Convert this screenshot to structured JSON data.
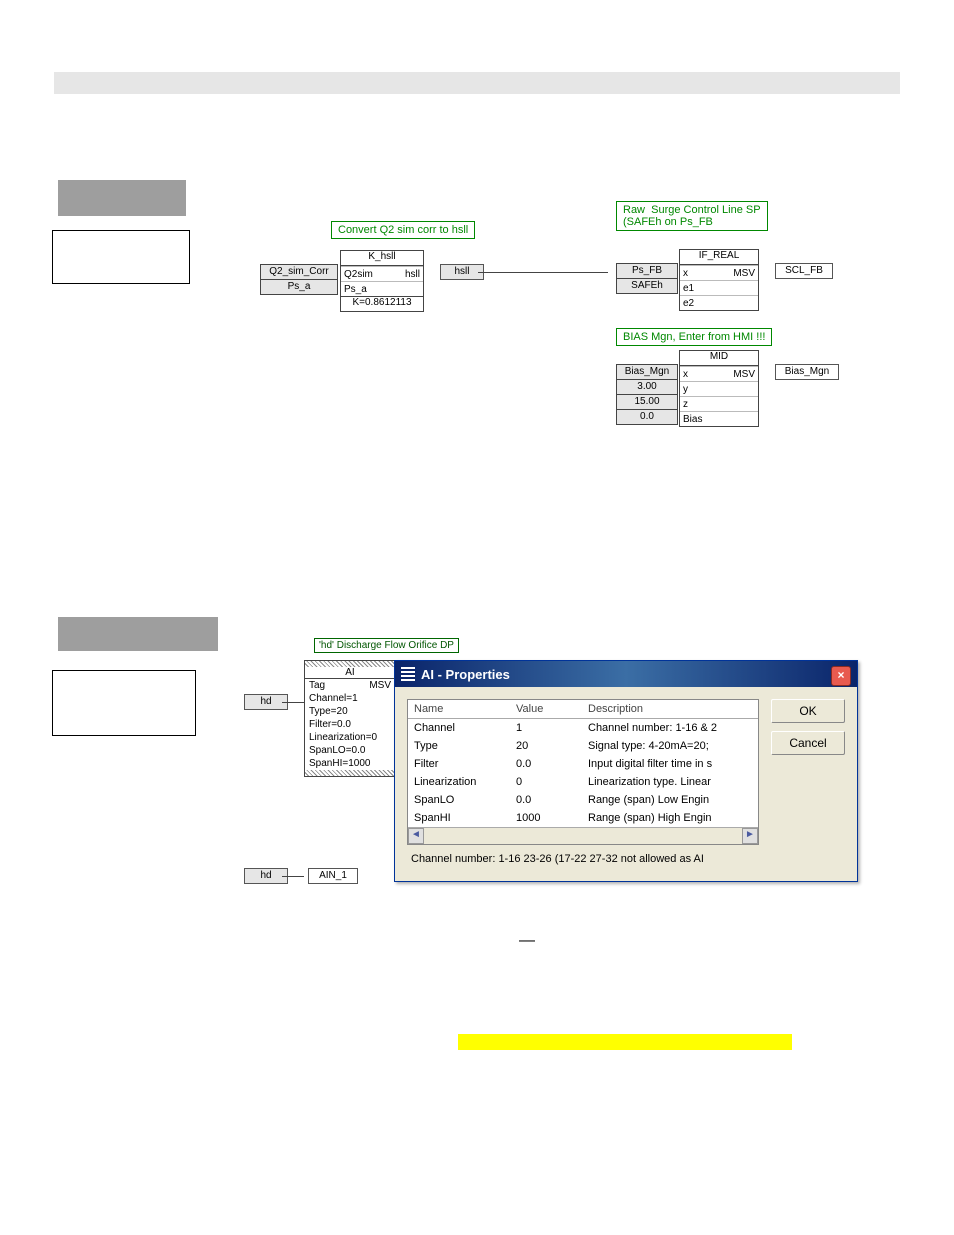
{
  "diagram_top": {
    "label_convert": "Convert Q2 sim corr to hsll",
    "kblock": {
      "title": "K_hsll",
      "in1": "Q2sim",
      "out": "hsll",
      "in2": "Ps_a",
      "k": "K=0.8612113"
    },
    "in_q2": "Q2_sim_Corr",
    "in_psa": "Ps_a",
    "var_hsll": "hsll",
    "label_raw": "Raw  Surge Control Line SP\n(SAFEh on Ps_FB",
    "if_real": {
      "title": "IF_REAL",
      "x": "x",
      "msv": "MSV",
      "e1": "e1",
      "e2": "e2",
      "in_ps": "Ps_FB",
      "in_safe": "SAFEh",
      "out": "SCL_FB"
    },
    "label_bias": "BIAS Mgn, Enter from HMI !!!",
    "mid": {
      "title": "MID",
      "x": "x",
      "msv": "MSV",
      "y": "y",
      "z": "z",
      "bias": "Bias",
      "in1": "Bias_Mgn",
      "in2": "3.00",
      "in3": "15.00",
      "in4": "0.0",
      "out": "Bias_Mgn"
    }
  },
  "diagram_bottom": {
    "hd_label": "'hd' Discharge Flow Orifice DP",
    "ai_block": {
      "title": "AI",
      "tag_l": "Tag",
      "msv": "MSV",
      "rows": [
        "Channel=1",
        "Type=20",
        "Filter=0.0",
        "Linearization=0",
        "SpanLO=0.0",
        "SpanHI=1000"
      ]
    },
    "hd": "hd",
    "ain1": "AIN_1"
  },
  "dialog": {
    "title": "AI - Properties",
    "headers": {
      "name": "Name",
      "value": "Value",
      "desc": "Description"
    },
    "rows": [
      {
        "n": "Channel",
        "v": "1",
        "d": "Channel number: 1-16 & 2"
      },
      {
        "n": "Type",
        "v": "20",
        "d": "Signal type: 4-20mA=20;"
      },
      {
        "n": "Filter",
        "v": "0.0",
        "d": "Input digital filter time in s"
      },
      {
        "n": "Linearization",
        "v": "0",
        "d": "Linearization type. Linear"
      },
      {
        "n": "SpanLO",
        "v": "0.0",
        "d": "Range (span) Low Engin"
      },
      {
        "n": "SpanHI",
        "v": "1000",
        "d": "Range (span) High Engin"
      }
    ],
    "ok": "OK",
    "cancel": "Cancel",
    "status": "Channel number: 1-16  23-26 (17-22  27-32 not allowed as AI"
  }
}
